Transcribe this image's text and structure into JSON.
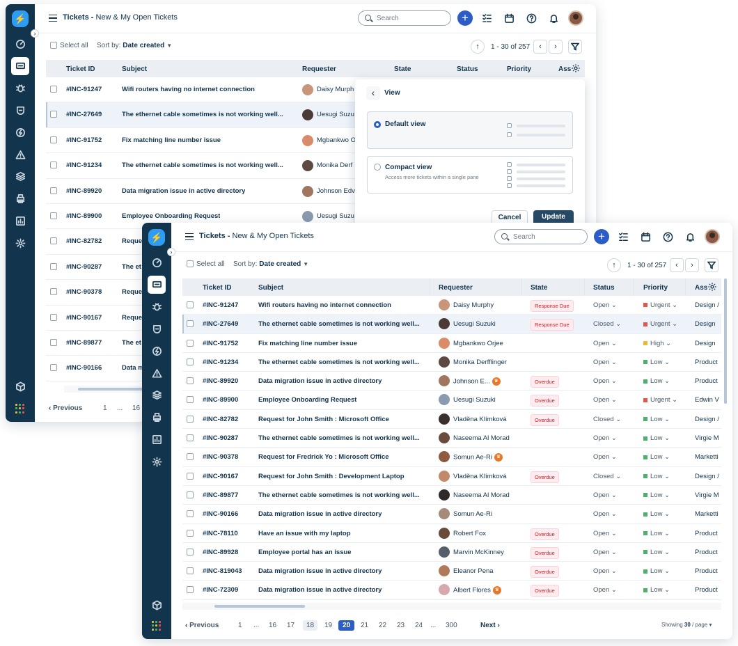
{
  "app": {
    "title": "Tickets",
    "subtitle": "New & My Open Tickets",
    "search_placeholder": "Search"
  },
  "toolbar": {
    "select_all": "Select all",
    "sort_by": "Sort by:",
    "sort_value": "Date created",
    "pagination": "1 - 30 of 257"
  },
  "columns": {
    "id": "Ticket ID",
    "subject": "Subject",
    "requester": "Requester",
    "state": "State",
    "status": "Status",
    "priority": "Priority",
    "group": "Ass"
  },
  "colors": {
    "sidebar": "#12344d",
    "accent": "#2c5cc5",
    "urgent": "#e2574c",
    "high": "#e9b937",
    "low": "#4fb06c"
  },
  "tickets": [
    {
      "id": "#INC-91247",
      "subject": "Wifi routers having no internet connection",
      "requester": "Daisy Murphy",
      "state": "Response Due",
      "status": "Open",
      "priority": "Urgent",
      "group": "Design /"
    },
    {
      "id": "#INC-27649",
      "subject": "The ethernet cable sometimes is not working well...",
      "requester": "Uesugi Suzuki",
      "state": "Response Due",
      "status": "Closed",
      "priority": "Urgent",
      "group": "Design"
    },
    {
      "id": "#INC-91752",
      "subject": "Fix matching line number issue",
      "requester": "Mgbankwo Orjee",
      "state": "",
      "status": "Open",
      "priority": "High",
      "group": "Design"
    },
    {
      "id": "#INC-91234",
      "subject": "The ethernet cable sometimes is not working well...",
      "requester": "Monika Derfflinger",
      "state": "",
      "status": "Open",
      "priority": "Low",
      "group": "Product"
    },
    {
      "id": "#INC-89920",
      "subject": "Data migration issue in active directory",
      "requester": "Johnson E...",
      "state": "Overdue",
      "status": "Open",
      "priority": "Low",
      "group": "Product"
    },
    {
      "id": "#INC-89900",
      "subject": "Employee Onboarding Request",
      "requester": "Uesugi Suzuki",
      "state": "Overdue",
      "status": "Open",
      "priority": "Urgent",
      "group": "Edwin V"
    },
    {
      "id": "#INC-82782",
      "subject": "Request for John Smith : Microsoft Office",
      "requester": "Vladěna Klímková",
      "state": "Overdue",
      "status": "Closed",
      "priority": "Low",
      "group": "Design /"
    },
    {
      "id": "#INC-90287",
      "subject": "The ethernet cable sometimes is not working well...",
      "requester": "Naseema Al Morad",
      "state": "",
      "status": "Open",
      "priority": "Low",
      "group": "Virgie M"
    },
    {
      "id": "#INC-90378",
      "subject": "Request for Fredrick Yo : Microsoft Office",
      "requester": "Somun Ae-Ri",
      "state": "",
      "status": "Open",
      "priority": "Low",
      "group": "Marketti"
    },
    {
      "id": "#INC-90167",
      "subject": "Request for John Smith : Development Laptop",
      "requester": "Vladěna Klímková",
      "state": "Overdue",
      "status": "Closed",
      "priority": "Low",
      "group": "Design /"
    },
    {
      "id": "#INC-89877",
      "subject": "The ethernet cable sometimes is not working well...",
      "requester": "Naseema Al Morad",
      "state": "",
      "status": "Open",
      "priority": "Low",
      "group": "Virgie M"
    },
    {
      "id": "#INC-90166",
      "subject": "Data migration issue in active directory",
      "requester": "Somun Ae-Ri",
      "state": "",
      "status": "Open",
      "priority": "Low",
      "group": "Marketti"
    },
    {
      "id": "#INC-78110",
      "subject": "Have an issue with my laptop",
      "requester": "Robert Fox",
      "state": "Overdue",
      "status": "Open",
      "priority": "Low",
      "group": "Product"
    },
    {
      "id": "#INC-89928",
      "subject": "Employee portal has an issue",
      "requester": "Marvin McKinney",
      "state": "Overdue",
      "status": "Open",
      "priority": "Low",
      "group": "Product"
    },
    {
      "id": "#INC-819043",
      "subject": "Data migration issue in active directory",
      "requester": "Eleanor Pena",
      "state": "Overdue",
      "status": "Open",
      "priority": "Low",
      "group": "Product"
    },
    {
      "id": "#INC-72309",
      "subject": "Data migration issue in active directory",
      "requester": "Albert Flores",
      "state": "Overdue",
      "status": "Open",
      "priority": "Low",
      "group": "Product"
    }
  ],
  "back_window": {
    "requesters": [
      "Daisy Murph",
      "Uesugi Suzu",
      "Mgbankwo O",
      "Monika Derf",
      "Johnson Edv",
      "Uesugi Suzu"
    ],
    "subjects_trunc": [
      "Reque",
      "The et",
      "Reque",
      "Reque",
      "The et",
      "Data m"
    ],
    "extra_ids": [
      "#INC-82782",
      "#INC-90287",
      "#INC-90378",
      "#INC-90167",
      "#INC-89877",
      "#INC-90166"
    ],
    "footer": {
      "prev": "Previous",
      "p1": "1",
      "dots": "...",
      "p16": "16"
    }
  },
  "view_popup": {
    "title": "View",
    "default_label": "Default view",
    "compact_label": "Compact view",
    "compact_desc": "Access more tickets within a single pane",
    "cancel": "Cancel",
    "update": "Update"
  },
  "footer": {
    "prev": "Previous",
    "next": "Next",
    "pages": [
      "1",
      "...",
      "16",
      "17",
      "18",
      "19",
      "20",
      "21",
      "22",
      "23",
      "24",
      "...",
      "300"
    ],
    "current": "20",
    "showing_prefix": "Showing",
    "showing_count": "30",
    "showing_suffix": "/ page"
  }
}
